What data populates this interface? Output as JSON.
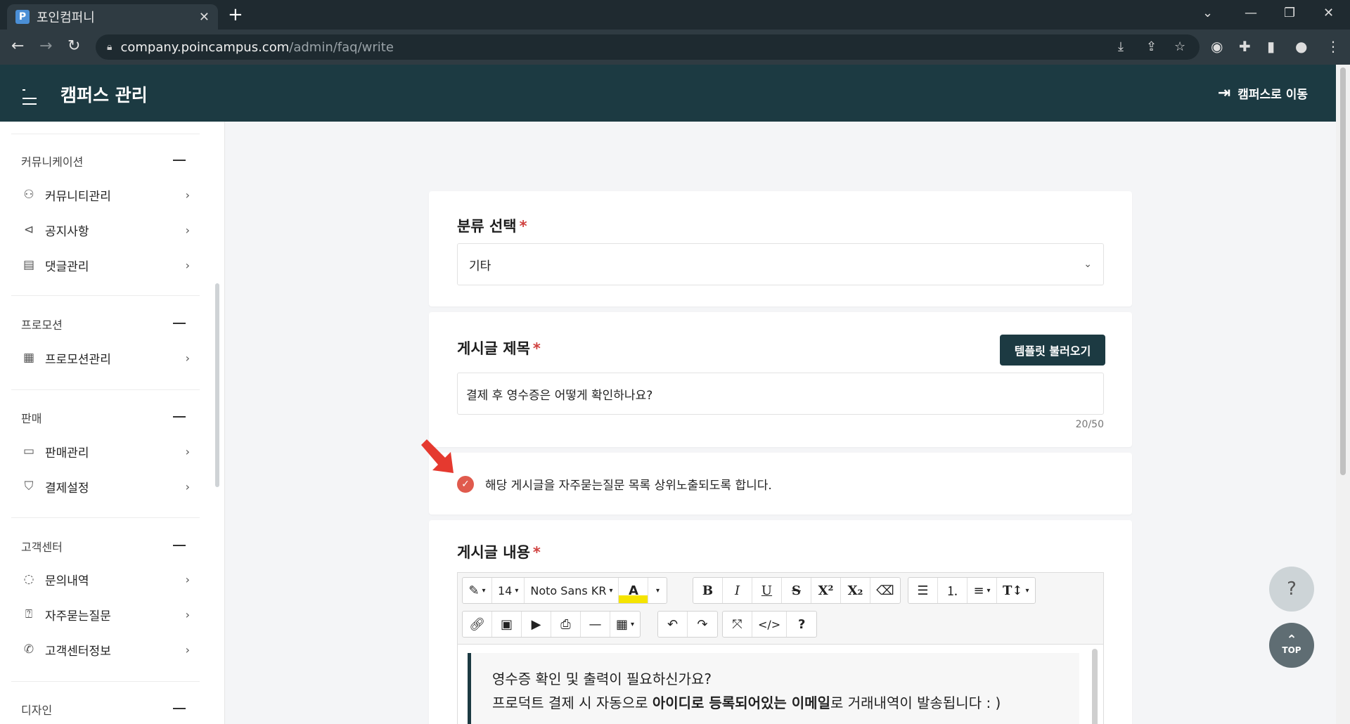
{
  "browser": {
    "tab_title": "포인컴퍼니",
    "favicon_letter": "P",
    "url_host": "company.poincampus.com",
    "url_path": "/admin/faq/write"
  },
  "header": {
    "title": "캠퍼스 관리",
    "goto_campus": "캠퍼스로 이동"
  },
  "sidebar": {
    "sections": [
      {
        "title": "커뮤니케이션",
        "items": [
          {
            "label": "커뮤니티관리",
            "icon": "users-icon"
          },
          {
            "label": "공지사항",
            "icon": "megaphone-icon"
          },
          {
            "label": "댓글관리",
            "icon": "comment-icon"
          }
        ]
      },
      {
        "title": "프로모션",
        "items": [
          {
            "label": "프로모션관리",
            "icon": "calendar-icon"
          }
        ]
      },
      {
        "title": "판매",
        "items": [
          {
            "label": "판매관리",
            "icon": "card-icon"
          },
          {
            "label": "결제설정",
            "icon": "bag-icon"
          }
        ]
      },
      {
        "title": "고객센터",
        "items": [
          {
            "label": "문의내역",
            "icon": "chat-icon"
          },
          {
            "label": "자주묻는질문",
            "icon": "question-icon"
          },
          {
            "label": "고객센터정보",
            "icon": "phone-icon"
          }
        ]
      },
      {
        "title": "디자인",
        "items": []
      }
    ]
  },
  "form": {
    "category": {
      "label": "분류 선택",
      "required_mark": "*",
      "value": "기타"
    },
    "title": {
      "label": "게시글 제목",
      "required_mark": "*",
      "template_button": "템플릿 불러오기",
      "value": "결제 후 영수증은 어떻게 확인하나요?",
      "counter": "20/50"
    },
    "pin_checkbox": {
      "label": "해당 게시글을 자주묻는질문 목록 상위노출되도록 합니다.",
      "checked": true
    },
    "content": {
      "label": "게시글 내용",
      "required_mark": "*",
      "toolbar": {
        "font_size": "14",
        "font_family": "Noto Sans KR"
      },
      "body_line1": "영수증 확인 및 출력이 필요하신가요?",
      "body_line2_before": "프로덕트 결제 시 자동으로 ",
      "body_line2_bold": "아이디로 등록되어있는 이메일",
      "body_line2_after": "로 거래내역이 발송됩니다 : )"
    }
  },
  "floating": {
    "help": "?",
    "top": "TOP"
  },
  "colors": {
    "header_bg": "#1c3a42",
    "required": "#d0413f",
    "checkbox": "#e05a4d",
    "arrow": "#e5392f"
  }
}
